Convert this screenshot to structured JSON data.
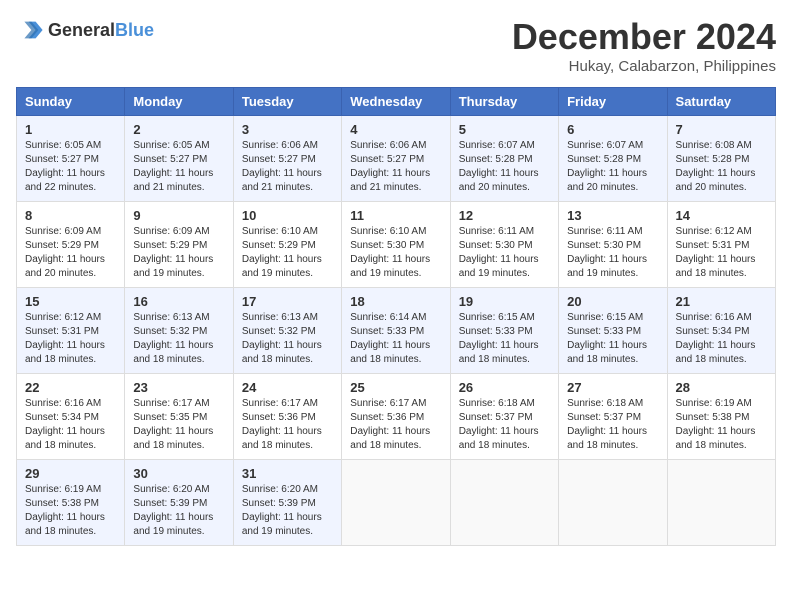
{
  "header": {
    "logo": {
      "general": "General",
      "blue": "Blue"
    },
    "title": "December 2024",
    "subtitle": "Hukay, Calabarzon, Philippines"
  },
  "calendar": {
    "days_of_week": [
      "Sunday",
      "Monday",
      "Tuesday",
      "Wednesday",
      "Thursday",
      "Friday",
      "Saturday"
    ],
    "weeks": [
      [
        {
          "day": "",
          "info": ""
        },
        {
          "day": "",
          "info": ""
        },
        {
          "day": "",
          "info": ""
        },
        {
          "day": "",
          "info": ""
        },
        {
          "day": "",
          "info": ""
        },
        {
          "day": "",
          "info": ""
        },
        {
          "day": "",
          "info": ""
        }
      ],
      [
        {
          "day": "1",
          "sunrise": "6:05 AM",
          "sunset": "5:27 PM",
          "daylight": "11 hours and 22 minutes."
        },
        {
          "day": "2",
          "sunrise": "6:05 AM",
          "sunset": "5:27 PM",
          "daylight": "11 hours and 21 minutes."
        },
        {
          "day": "3",
          "sunrise": "6:06 AM",
          "sunset": "5:27 PM",
          "daylight": "11 hours and 21 minutes."
        },
        {
          "day": "4",
          "sunrise": "6:06 AM",
          "sunset": "5:27 PM",
          "daylight": "11 hours and 21 minutes."
        },
        {
          "day": "5",
          "sunrise": "6:07 AM",
          "sunset": "5:28 PM",
          "daylight": "11 hours and 20 minutes."
        },
        {
          "day": "6",
          "sunrise": "6:07 AM",
          "sunset": "5:28 PM",
          "daylight": "11 hours and 20 minutes."
        },
        {
          "day": "7",
          "sunrise": "6:08 AM",
          "sunset": "5:28 PM",
          "daylight": "11 hours and 20 minutes."
        }
      ],
      [
        {
          "day": "8",
          "sunrise": "6:09 AM",
          "sunset": "5:29 PM",
          "daylight": "11 hours and 20 minutes."
        },
        {
          "day": "9",
          "sunrise": "6:09 AM",
          "sunset": "5:29 PM",
          "daylight": "11 hours and 19 minutes."
        },
        {
          "day": "10",
          "sunrise": "6:10 AM",
          "sunset": "5:29 PM",
          "daylight": "11 hours and 19 minutes."
        },
        {
          "day": "11",
          "sunrise": "6:10 AM",
          "sunset": "5:30 PM",
          "daylight": "11 hours and 19 minutes."
        },
        {
          "day": "12",
          "sunrise": "6:11 AM",
          "sunset": "5:30 PM",
          "daylight": "11 hours and 19 minutes."
        },
        {
          "day": "13",
          "sunrise": "6:11 AM",
          "sunset": "5:30 PM",
          "daylight": "11 hours and 19 minutes."
        },
        {
          "day": "14",
          "sunrise": "6:12 AM",
          "sunset": "5:31 PM",
          "daylight": "11 hours and 18 minutes."
        }
      ],
      [
        {
          "day": "15",
          "sunrise": "6:12 AM",
          "sunset": "5:31 PM",
          "daylight": "11 hours and 18 minutes."
        },
        {
          "day": "16",
          "sunrise": "6:13 AM",
          "sunset": "5:32 PM",
          "daylight": "11 hours and 18 minutes."
        },
        {
          "day": "17",
          "sunrise": "6:13 AM",
          "sunset": "5:32 PM",
          "daylight": "11 hours and 18 minutes."
        },
        {
          "day": "18",
          "sunrise": "6:14 AM",
          "sunset": "5:33 PM",
          "daylight": "11 hours and 18 minutes."
        },
        {
          "day": "19",
          "sunrise": "6:15 AM",
          "sunset": "5:33 PM",
          "daylight": "11 hours and 18 minutes."
        },
        {
          "day": "20",
          "sunrise": "6:15 AM",
          "sunset": "5:33 PM",
          "daylight": "11 hours and 18 minutes."
        },
        {
          "day": "21",
          "sunrise": "6:16 AM",
          "sunset": "5:34 PM",
          "daylight": "11 hours and 18 minutes."
        }
      ],
      [
        {
          "day": "22",
          "sunrise": "6:16 AM",
          "sunset": "5:34 PM",
          "daylight": "11 hours and 18 minutes."
        },
        {
          "day": "23",
          "sunrise": "6:17 AM",
          "sunset": "5:35 PM",
          "daylight": "11 hours and 18 minutes."
        },
        {
          "day": "24",
          "sunrise": "6:17 AM",
          "sunset": "5:36 PM",
          "daylight": "11 hours and 18 minutes."
        },
        {
          "day": "25",
          "sunrise": "6:17 AM",
          "sunset": "5:36 PM",
          "daylight": "11 hours and 18 minutes."
        },
        {
          "day": "26",
          "sunrise": "6:18 AM",
          "sunset": "5:37 PM",
          "daylight": "11 hours and 18 minutes."
        },
        {
          "day": "27",
          "sunrise": "6:18 AM",
          "sunset": "5:37 PM",
          "daylight": "11 hours and 18 minutes."
        },
        {
          "day": "28",
          "sunrise": "6:19 AM",
          "sunset": "5:38 PM",
          "daylight": "11 hours and 18 minutes."
        }
      ],
      [
        {
          "day": "29",
          "sunrise": "6:19 AM",
          "sunset": "5:38 PM",
          "daylight": "11 hours and 18 minutes."
        },
        {
          "day": "30",
          "sunrise": "6:20 AM",
          "sunset": "5:39 PM",
          "daylight": "11 hours and 19 minutes."
        },
        {
          "day": "31",
          "sunrise": "6:20 AM",
          "sunset": "5:39 PM",
          "daylight": "11 hours and 19 minutes."
        },
        {
          "day": "",
          "info": ""
        },
        {
          "day": "",
          "info": ""
        },
        {
          "day": "",
          "info": ""
        },
        {
          "day": "",
          "info": ""
        }
      ]
    ]
  }
}
